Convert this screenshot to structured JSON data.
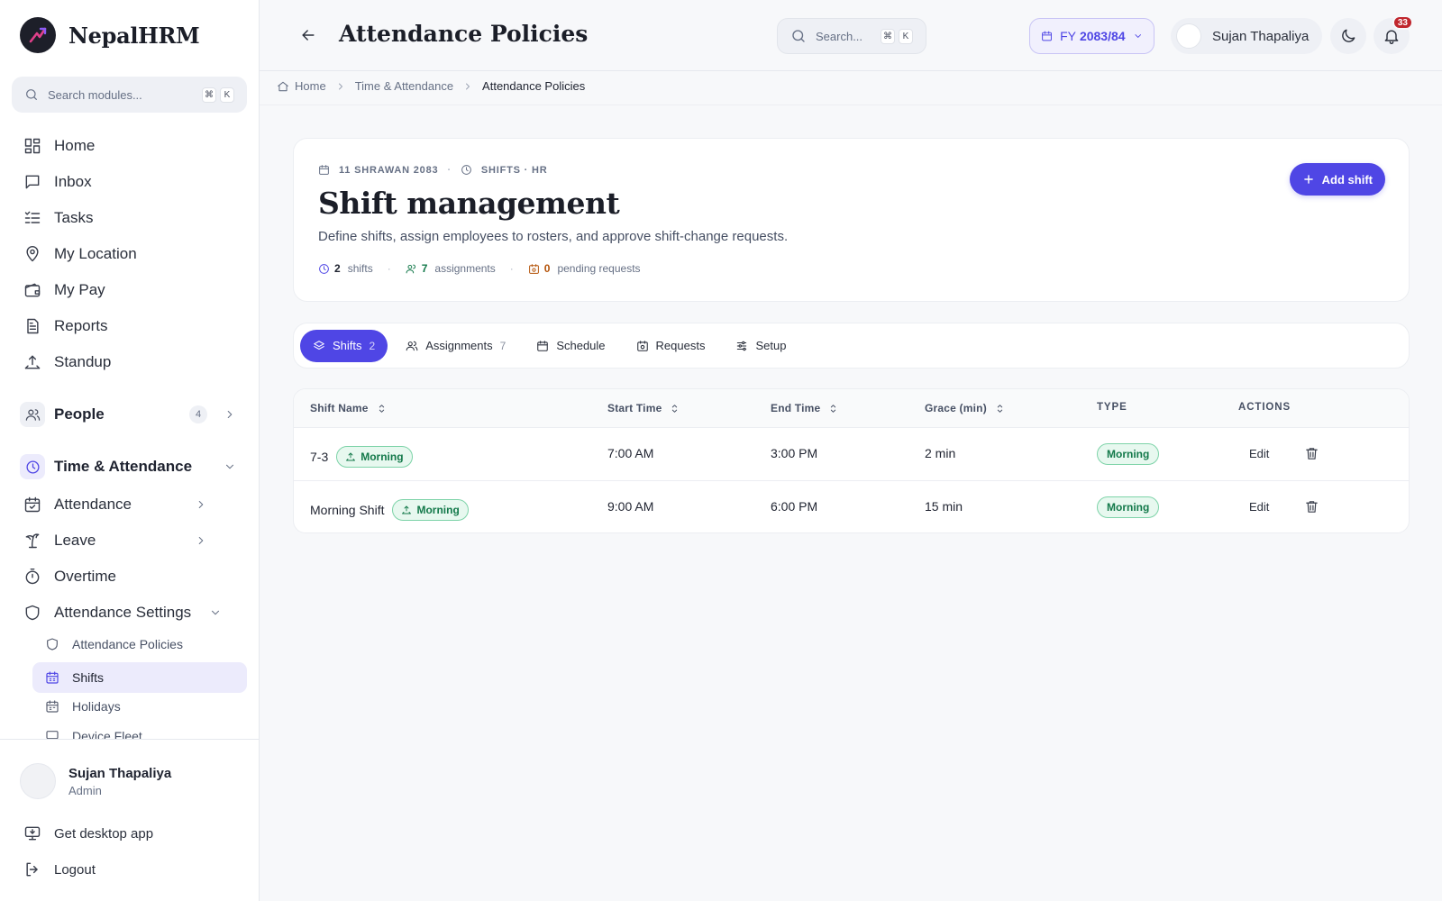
{
  "app": {
    "name": "NepalHRM"
  },
  "sidebar": {
    "search": {
      "placeholder": "Search modules...",
      "key1": "⌘",
      "key2": "K"
    },
    "nav": [
      {
        "label": "Home"
      },
      {
        "label": "Inbox"
      },
      {
        "label": "Tasks"
      },
      {
        "label": "My Location"
      },
      {
        "label": "My Pay"
      },
      {
        "label": "Reports"
      },
      {
        "label": "Standup"
      }
    ],
    "people": {
      "label": "People",
      "badge": "4"
    },
    "time_attendance": {
      "label": "Time & Attendance"
    },
    "attendance": {
      "label": "Attendance"
    },
    "leave": {
      "label": "Leave"
    },
    "overtime": {
      "label": "Overtime"
    },
    "attendance_settings": {
      "label": "Attendance Settings"
    },
    "sub": [
      {
        "label": "Attendance Policies"
      },
      {
        "label": "Shifts"
      },
      {
        "label": "Holidays"
      },
      {
        "label": "Device Fleet"
      }
    ],
    "user": {
      "name": "Sujan Thapaliya",
      "role": "Admin"
    },
    "desktop_app": "Get desktop app",
    "logout": "Logout"
  },
  "topbar": {
    "title": "Attendance Policies",
    "search_placeholder": "Search...",
    "key1": "⌘",
    "key2": "K",
    "fy_prefix": "FY",
    "fy_value": "2083/84",
    "user_name": "Sujan Thapaliya",
    "notifications": "33"
  },
  "breadcrumb": {
    "home": "Home",
    "section": "Time & Attendance",
    "current": "Attendance Policies"
  },
  "header": {
    "date": "11 SHRAWAN 2083",
    "scope": "SHIFTS · HR",
    "title": "Shift management",
    "subtitle": "Define shifts, assign employees to rosters, and approve shift-change requests.",
    "shifts_count": "2",
    "shifts_label": "shifts",
    "assignments_count": "7",
    "assignments_label": "assignments",
    "pending_count": "0",
    "pending_label": "pending requests",
    "add_label": "Add shift"
  },
  "tabs": [
    {
      "label": "Shifts",
      "count": "2"
    },
    {
      "label": "Assignments",
      "count": "7"
    },
    {
      "label": "Schedule"
    },
    {
      "label": "Requests"
    },
    {
      "label": "Setup"
    }
  ],
  "table": {
    "headers": {
      "name": "Shift Name",
      "start": "Start Time",
      "end": "End Time",
      "grace": "Grace (min)",
      "type": "TYPE",
      "actions": "ACTIONS"
    },
    "rows": [
      {
        "name": "7-3",
        "tag": "Morning",
        "start": "7:00 AM",
        "end": "3:00 PM",
        "grace": "2 min",
        "type": "Morning",
        "edit": "Edit"
      },
      {
        "name": "Morning Shift",
        "tag": "Morning",
        "start": "9:00 AM",
        "end": "6:00 PM",
        "grace": "15 min",
        "type": "Morning",
        "edit": "Edit"
      }
    ]
  },
  "colors": {
    "accent": "#4f46e5",
    "tag_green": "#13794a",
    "badge_red": "#c0262d"
  }
}
